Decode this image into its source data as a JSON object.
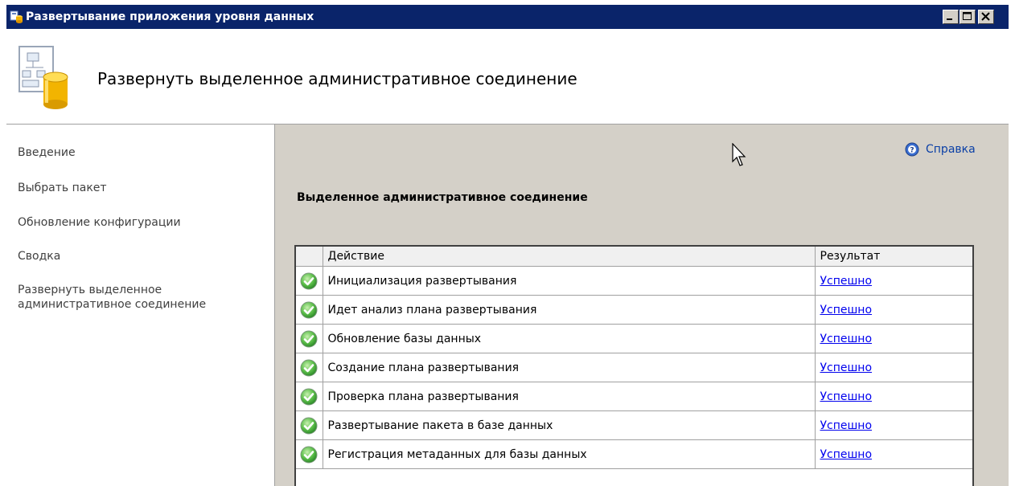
{
  "window": {
    "title": "Развертывание приложения уровня данных",
    "title_icon": "app-icon"
  },
  "header": {
    "title": "Развернуть выделенное административное соединение",
    "icon": "database-deploy-icon"
  },
  "sidebar": {
    "items": [
      {
        "label": "Введение"
      },
      {
        "label": "Выбрать пакет"
      },
      {
        "label": "Обновление конфигурации"
      },
      {
        "label": "Сводка"
      },
      {
        "label_line1": "Развернуть выделенное",
        "label_line2": "административное соединение"
      }
    ]
  },
  "content": {
    "help_label": "Справка",
    "section_title": "Выделенное административное соединение",
    "columns": {
      "action": "Действие",
      "result": "Результат"
    },
    "rows": [
      {
        "action": "Инициализация развертывания",
        "result": "Успешно",
        "status": "success"
      },
      {
        "action": "Идет анализ плана развертывания",
        "result": "Успешно",
        "status": "success"
      },
      {
        "action": "Обновление базы данных",
        "result": "Успешно",
        "status": "success"
      },
      {
        "action": "Создание плана развертывания",
        "result": "Успешно",
        "status": "success"
      },
      {
        "action": "Проверка плана развертывания",
        "result": "Успешно",
        "status": "success"
      },
      {
        "action": "Развертывание пакета в базе данных",
        "result": "Успешно",
        "status": "success"
      },
      {
        "action": "Регистрация метаданных для базы данных",
        "result": "Успешно",
        "status": "success"
      }
    ]
  },
  "colors": {
    "titlebar": "#0a246a",
    "panel": "#d4d0c8",
    "link": "#0000ee",
    "success": "#3ca83c"
  }
}
